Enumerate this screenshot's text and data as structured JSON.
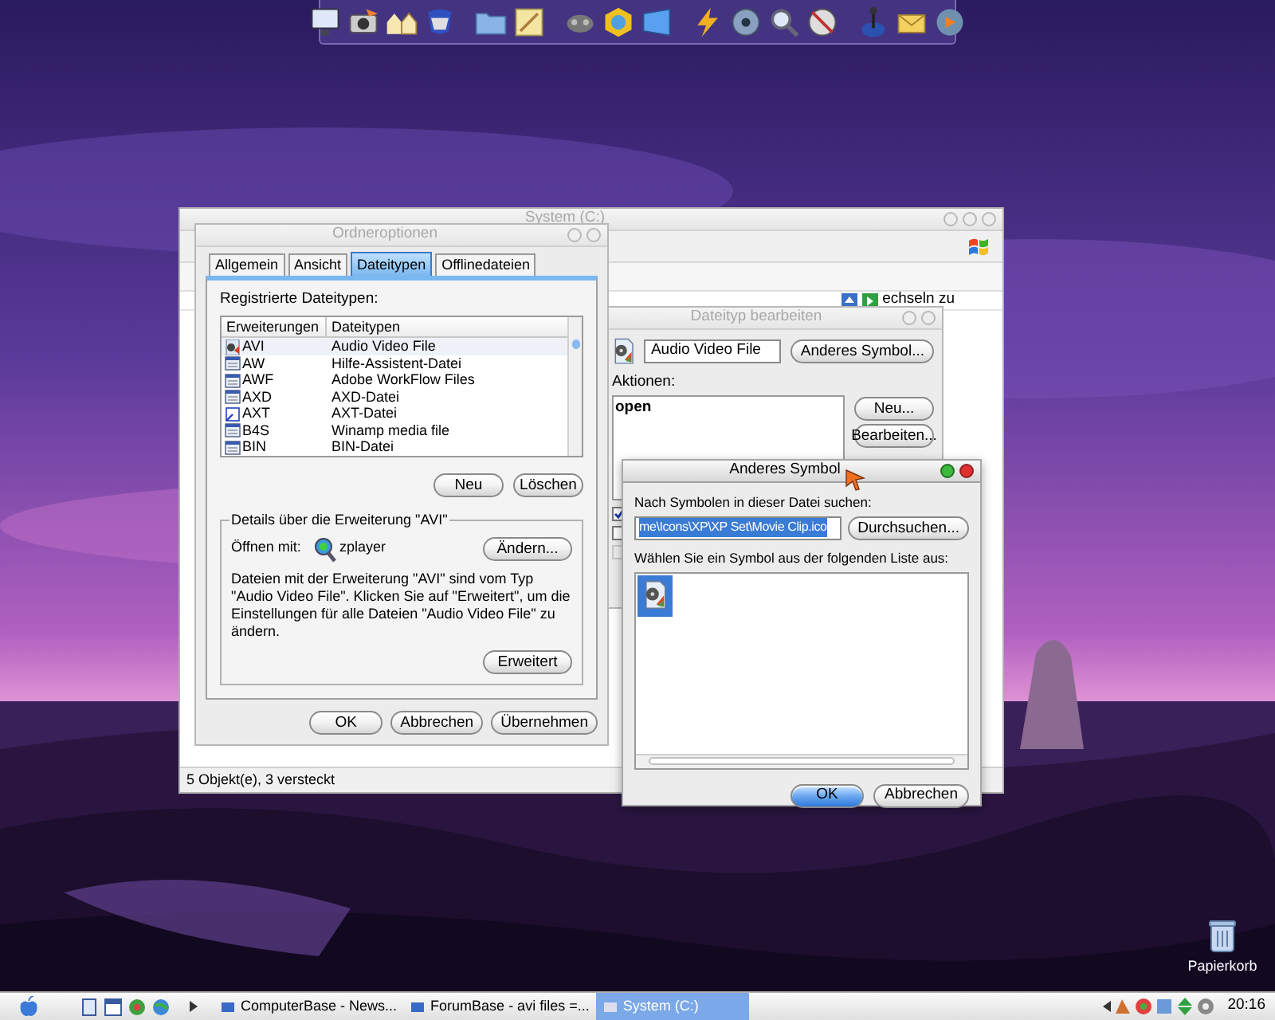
{
  "desktop": {
    "icons": [
      {
        "label": "Papierkorb"
      }
    ]
  },
  "explorer": {
    "title": "System (C:)",
    "active": false,
    "address_text": "echseln zu",
    "status_bar": "5 Objekt(e), 3 versteckt"
  },
  "folder_options": {
    "title": "Ordneroptionen",
    "active": false,
    "tabs": [
      {
        "label": "Allgemein",
        "selected": false
      },
      {
        "label": "Ansicht",
        "selected": false
      },
      {
        "label": "Dateitypen",
        "selected": true
      },
      {
        "label": "Offlinedateien",
        "selected": false
      }
    ],
    "list_label": "Registrierte Dateitypen:",
    "columns": [
      "Erweiterungen",
      "Dateitypen"
    ],
    "rows": [
      {
        "extension": "AVI",
        "type": "Audio Video File",
        "kind": "video",
        "selected": true
      },
      {
        "extension": "AW",
        "type": "Hilfe-Assistent-Datei",
        "kind": "document",
        "selected": false
      },
      {
        "extension": "AWF",
        "type": "Adobe WorkFlow Files",
        "kind": "document",
        "selected": false
      },
      {
        "extension": "AXD",
        "type": "AXD-Datei",
        "kind": "document",
        "selected": false
      },
      {
        "extension": "AXT",
        "type": "AXT-Datei",
        "kind": "link",
        "selected": false
      },
      {
        "extension": "B4S",
        "type": "Winamp media file",
        "kind": "document",
        "selected": false
      },
      {
        "extension": "BIN",
        "type": "BIN-Datei",
        "kind": "document",
        "selected": false
      }
    ],
    "list_buttons": [
      "Neu",
      "Löschen"
    ],
    "details": {
      "title": "Details über die Erweiterung \"AVI\"",
      "open_with_label": "Öffnen mit:",
      "program": "zplayer",
      "change_button": "Ändern...",
      "description": "Dateien mit der Erweiterung \"AVI\" sind vom Typ \"Audio Video File\". Klicken Sie auf \"Erweitert\", um die Einstellungen für alle Dateien \"Audio Video File\" zu ändern.",
      "advanced_button": "Erweitert"
    },
    "buttons": [
      "OK",
      "Abbrechen",
      "Übernehmen"
    ]
  },
  "edit_file_type": {
    "title": "Dateityp bearbeiten",
    "active": false,
    "name_value": "Audio Video File",
    "change_icon_button": "Anderes Symbol...",
    "actions_label": "Aktionen:",
    "actions": [
      "open"
    ],
    "action_buttons": [
      "Neu...",
      "Bearbeiten..."
    ],
    "checkboxes": [
      {
        "checked": true,
        "disabled": false
      },
      {
        "checked": false,
        "disabled": false
      },
      {
        "checked": false,
        "disabled": true
      }
    ]
  },
  "change_icon": {
    "title": "Anderes Symbol",
    "active": true,
    "search_label": "Nach Symbolen in dieser Datei suchen:",
    "file_value": "me\\Icons\\XP\\XP Set\\Movie Clip.ico",
    "text_selected": true,
    "browse_button": "Durchsuchen...",
    "list_label": "Wählen Sie ein Symbol aus der folgenden Liste aus:",
    "icons": [
      {
        "selected": true
      }
    ],
    "buttons": [
      {
        "label": "OK",
        "default": true
      },
      {
        "label": "Abbrechen",
        "default": false
      }
    ]
  },
  "taskbar": {
    "tasks": [
      {
        "label": "ComputerBase - News...",
        "selected": false
      },
      {
        "label": "ForumBase - avi files =...",
        "selected": false
      },
      {
        "label": "System (C:)",
        "selected": true
      }
    ],
    "clock": "20:16"
  }
}
